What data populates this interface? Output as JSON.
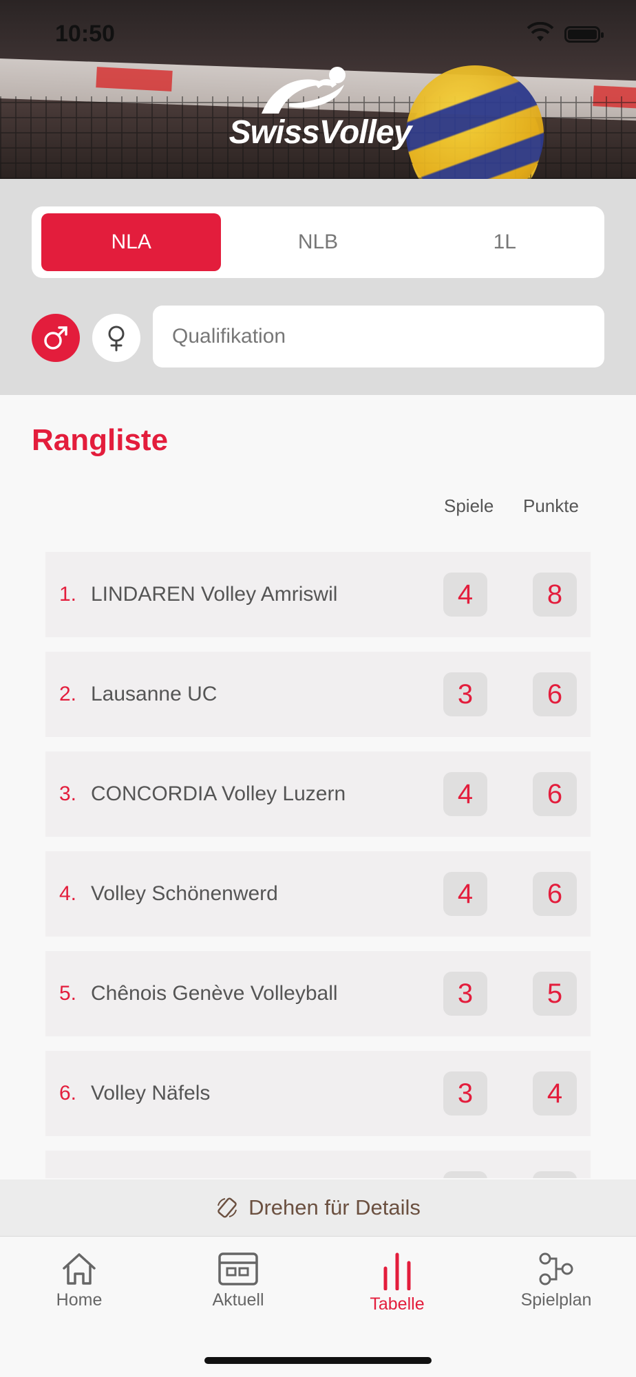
{
  "status_bar": {
    "time": "10:50"
  },
  "header": {
    "logo_text": "SwissVolley"
  },
  "league_tabs": [
    {
      "label": "NLA",
      "active": true
    },
    {
      "label": "NLB",
      "active": false
    },
    {
      "label": "1L",
      "active": false
    }
  ],
  "gender_filter": {
    "male_icon": "male-symbol-icon",
    "female_icon": "female-symbol-icon",
    "selected": "male"
  },
  "phase_select": {
    "value": "Qualifikation"
  },
  "ranking": {
    "title": "Rangliste",
    "col_games": "Spiele",
    "col_points": "Punkte",
    "rows": [
      {
        "rank": "1.",
        "team": "LINDAREN Volley Amriswil",
        "games": "4",
        "points": "8"
      },
      {
        "rank": "2.",
        "team": "Lausanne UC",
        "games": "3",
        "points": "6"
      },
      {
        "rank": "3.",
        "team": "CONCORDIA Volley Luzern",
        "games": "4",
        "points": "6"
      },
      {
        "rank": "4.",
        "team": "Volley Schönenwerd",
        "games": "4",
        "points": "6"
      },
      {
        "rank": "5.",
        "team": "Chênois Genève Volleyball",
        "games": "3",
        "points": "5"
      },
      {
        "rank": "6.",
        "team": "Volley Näfels",
        "games": "3",
        "points": "4"
      },
      {
        "rank": "",
        "team": "",
        "games": "",
        "points": ""
      }
    ]
  },
  "rotate_hint": {
    "label": "Drehen für Details",
    "icon": "rotate-device-icon"
  },
  "tabbar": [
    {
      "label": "Home",
      "icon": "home-icon"
    },
    {
      "label": "Aktuell",
      "icon": "news-icon"
    },
    {
      "label": "Tabelle",
      "icon": "bar-chart-icon",
      "active": true
    },
    {
      "label": "Spielplan",
      "icon": "schedule-icon"
    }
  ],
  "colors": {
    "accent": "#e31d3c",
    "background": "#f8f8f8",
    "filter_bg": "#dcdcdc",
    "row_bg": "#f1eff0"
  }
}
